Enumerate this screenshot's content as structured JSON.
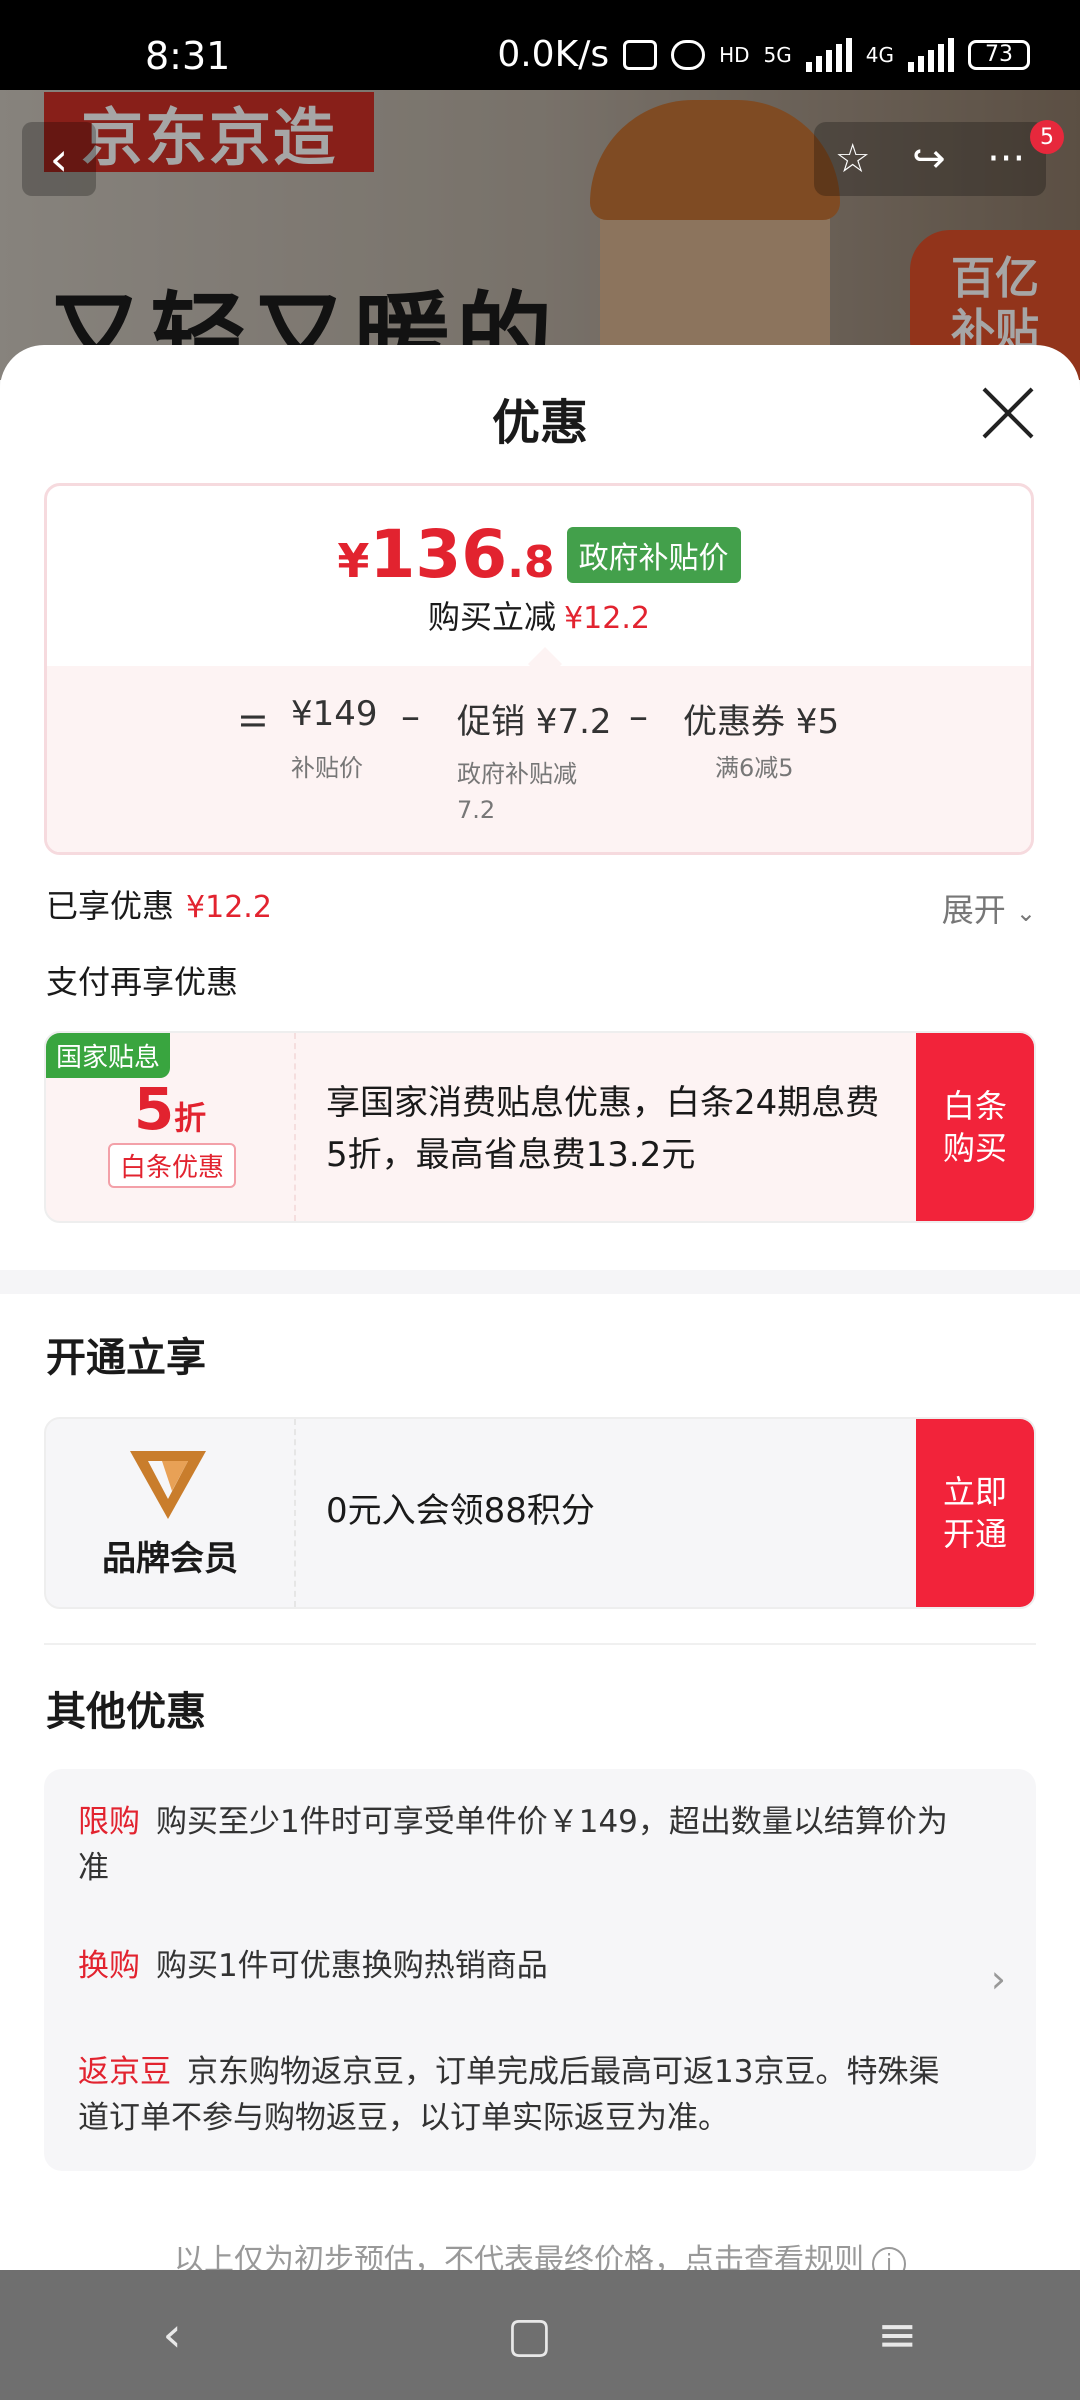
{
  "status_bar": {
    "time": "8:31",
    "network_speed": "0.0K/s",
    "signal1": "5G",
    "signal2": "4G",
    "hd": "HD",
    "battery": "73"
  },
  "backdrop": {
    "brand": "京东京造",
    "slogan": "又轻又暖的",
    "subsidy_badge_line1": "百亿",
    "subsidy_badge_line2": "补贴",
    "notification_count": "5"
  },
  "sheet": {
    "title": "优惠",
    "price": {
      "yen": "¥",
      "integer": "136",
      "decimal": ".8",
      "tag": "政府补贴价",
      "reduce_label": "购买立减",
      "reduce_amount": "¥12.2"
    },
    "breakdown": {
      "equals": "=",
      "base_value": "¥149",
      "base_label": "补贴价",
      "minus": "–",
      "promo_value": "促销 ¥7.2",
      "promo_label_line1": "政府补贴减",
      "promo_label_line2": "7.2",
      "coupon_value": "优惠券 ¥5",
      "coupon_label": "满6减5"
    },
    "enjoyed_label": "已享优惠",
    "enjoyed_amount": "¥12.2",
    "expand_label": "展开",
    "pay_heading": "支付再享优惠",
    "baitiao_promo": {
      "corner_tag": "国家贴息",
      "discount_number": "5",
      "discount_unit": "折",
      "sub_tag": "白条优惠",
      "text": "享国家消费贴息优惠，白条24期息费5折，最高省息费13.2元",
      "button_line1": "白条",
      "button_line2": "购买"
    },
    "open_heading": "开通立享",
    "member_promo": {
      "label": "品牌会员",
      "text": "0元入会领88积分",
      "button_line1": "立即",
      "button_line2": "开通"
    },
    "other_heading": "其他优惠",
    "other_items": [
      {
        "tag": "限购",
        "text": "购买至少1件时可享受单件价￥149，超出数量以结算价为准"
      },
      {
        "tag": "换购",
        "text": "购买1件可优惠换购热销商品"
      },
      {
        "tag": "返京豆",
        "text": "京东购物返京豆，订单完成后最高可返13京豆。特殊渠道订单不参与购物返豆，以订单实际返豆为准。"
      }
    ],
    "footnote": "以上仅为初步预估，不代表最终价格，点击查看规则"
  },
  "colors": {
    "accent_red": "#e2232f",
    "button_red": "#f2233a",
    "gov_green": "#43a04b",
    "national_green": "#39a53f"
  },
  "icons": [
    "back-icon",
    "star-icon",
    "share-icon",
    "more-icon",
    "close-icon",
    "chevron-down-icon",
    "chevron-right-icon",
    "info-icon",
    "brand-member-logo",
    "nav-back-icon",
    "nav-home-icon",
    "nav-menu-icon"
  ]
}
